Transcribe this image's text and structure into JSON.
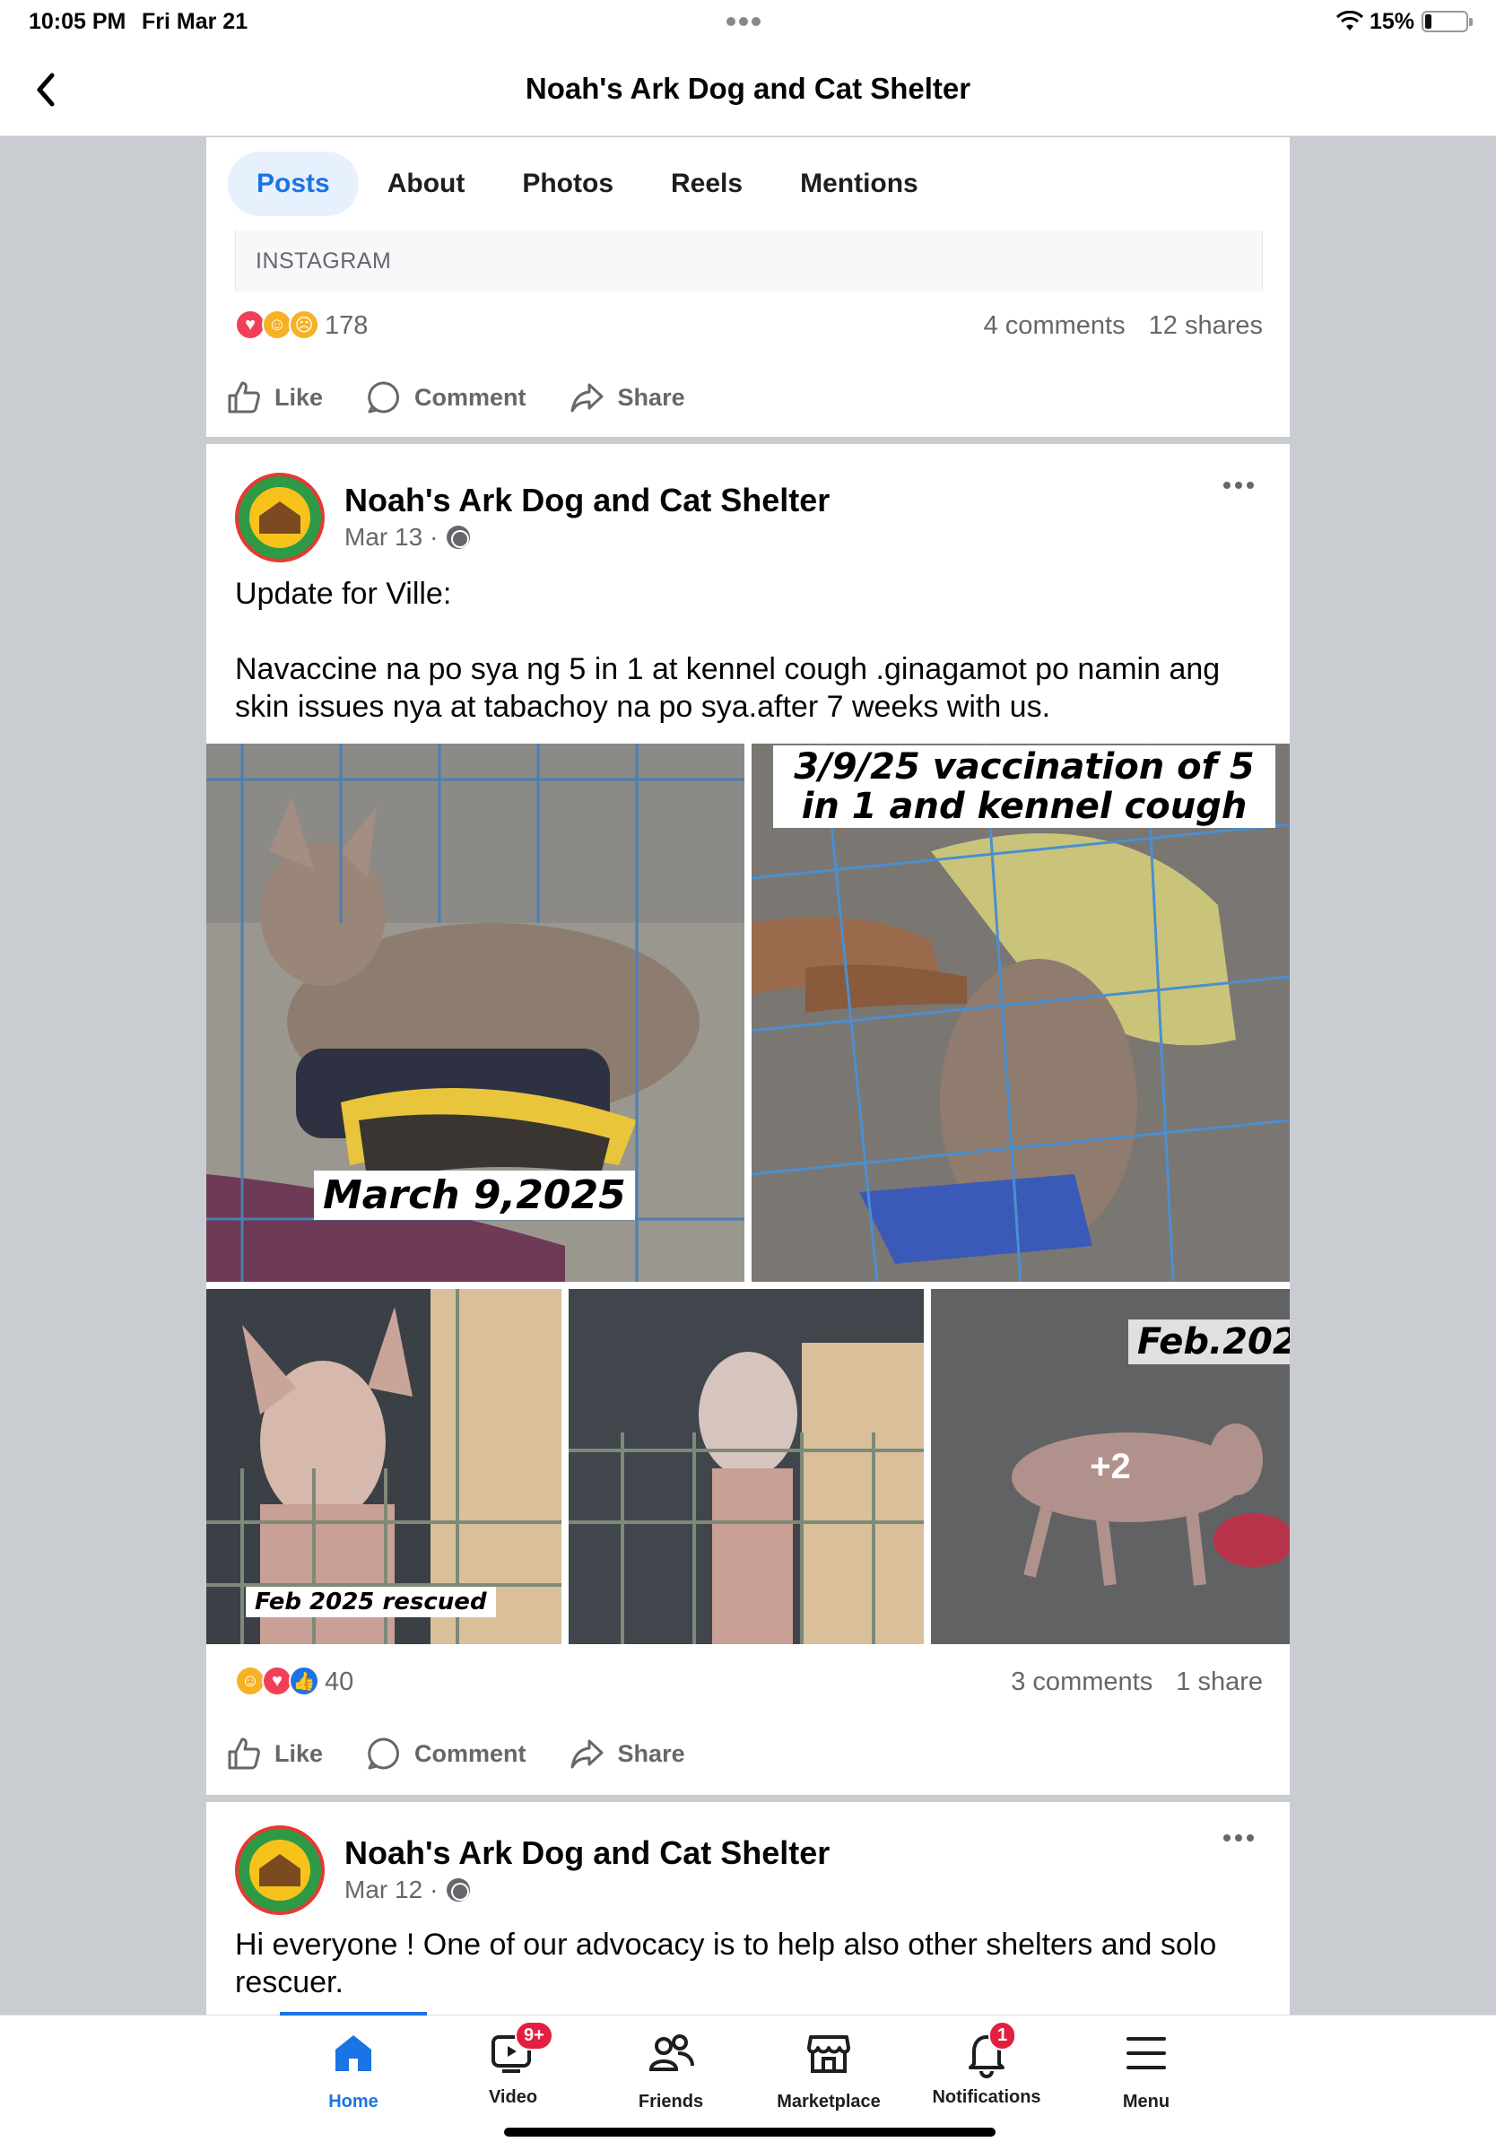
{
  "status_bar": {
    "time": "10:05 PM",
    "date": "Fri Mar 21",
    "battery_pct": "15%",
    "battery_level": 0.15
  },
  "header": {
    "title": "Noah's Ark Dog and Cat Shelter",
    "back_icon": "chevron-left-icon"
  },
  "tabs": [
    {
      "label": "Posts",
      "active": true
    },
    {
      "label": "About",
      "active": false
    },
    {
      "label": "Photos",
      "active": false
    },
    {
      "label": "Reels",
      "active": false
    },
    {
      "label": "Mentions",
      "active": false
    }
  ],
  "prev_post": {
    "source_label": "INSTAGRAM",
    "reaction_count": "178",
    "comments": "4 comments",
    "shares": "12 shares"
  },
  "actions": {
    "like": "Like",
    "comment": "Comment",
    "share": "Share"
  },
  "post1": {
    "author": "Noah's Ark Dog and Cat Shelter",
    "date": "Mar 13",
    "meta_sep": "·",
    "text_line1": "Update for Ville:",
    "text_line2": "Navaccine na po sya ng 5 in 1 at kennel cough .ginagamot po namin ang skin issues nya at tabachoy na po sya.after 7 weeks with us.",
    "photos": [
      {
        "caption": "March 9,2025"
      },
      {
        "caption": "3/9/25 vaccination of 5 in 1 and kennel cough"
      },
      {
        "caption": "Feb 2025 rescued"
      },
      {
        "caption": ""
      },
      {
        "caption": "Feb.202",
        "more": "+2"
      }
    ],
    "reaction_count": "40",
    "comments": "3 comments",
    "shares": "1 share"
  },
  "post2": {
    "author": "Noah's Ark Dog and Cat Shelter",
    "date": "Mar 12",
    "meta_sep": "·",
    "text": "Hi everyone ! One of our advocacy  is to help also other shelters and solo rescuer."
  },
  "bottom_nav": [
    {
      "label": "Home",
      "icon": "home-icon",
      "active": true
    },
    {
      "label": "Video",
      "icon": "video-icon",
      "badge": "9+"
    },
    {
      "label": "Friends",
      "icon": "friends-icon"
    },
    {
      "label": "Marketplace",
      "icon": "marketplace-icon"
    },
    {
      "label": "Notifications",
      "icon": "bell-icon",
      "badge": "1"
    },
    {
      "label": "Menu",
      "icon": "menu-icon"
    }
  ],
  "colors": {
    "accent": "#1b74e4",
    "background": "#c9ccd1",
    "badge": "#e41e3f"
  }
}
